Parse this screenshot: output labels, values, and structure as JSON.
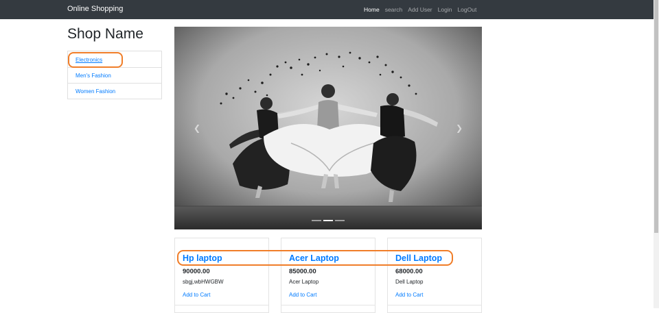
{
  "navbar": {
    "brand": "Online Shopping",
    "links": [
      "Home",
      "search",
      "Add User",
      "Login",
      "LogOut"
    ],
    "active": "Home"
  },
  "sidebar": {
    "shop_name": "Shop Name",
    "categories": [
      "Electronics",
      "Men's Fashion",
      "Women Fashion"
    ]
  },
  "carousel": {
    "prev_icon": "chevron-left-icon",
    "next_icon": "chevron-right-icon",
    "slides": 3,
    "active_slide": 2
  },
  "products": [
    {
      "title": "Hp laptop",
      "price": "90000.00",
      "description": "sbgj,wbHWGBW",
      "action": "Add to Cart"
    },
    {
      "title": "Acer Laptop",
      "price": "85000.00",
      "description": "Acer Laptop",
      "action": "Add to Cart"
    },
    {
      "title": "Dell Laptop",
      "price": "68000.00",
      "description": "Dell Laptop",
      "action": "Add to Cart"
    }
  ],
  "colors": {
    "navbar_bg": "#343a40",
    "link": "#007bff",
    "annotation": "#f07d28"
  }
}
